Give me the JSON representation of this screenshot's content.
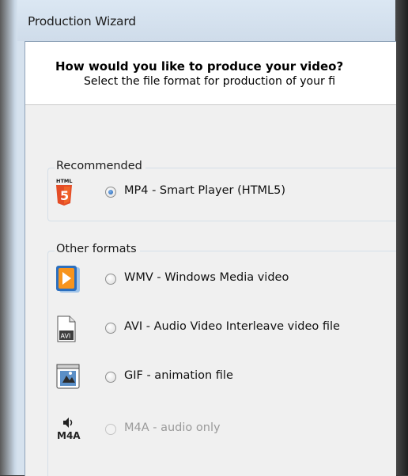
{
  "window": {
    "title": "Production Wizard"
  },
  "header": {
    "question": "How would you like to produce your video?",
    "subtitle": "Select the file format for production of your fi"
  },
  "groups": {
    "recommended": {
      "label": "Recommended",
      "options": [
        {
          "label": "MP4 - Smart Player (HTML5)",
          "checked": true,
          "enabled": true,
          "icon": "html5-icon"
        }
      ]
    },
    "other": {
      "label": "Other formats",
      "options": [
        {
          "label": "WMV - Windows Media video",
          "checked": false,
          "enabled": true,
          "icon": "windows-media-icon"
        },
        {
          "label": "AVI - Audio Video Interleave video file",
          "checked": false,
          "enabled": true,
          "icon": "avi-file-icon"
        },
        {
          "label": "GIF - animation file",
          "checked": false,
          "enabled": true,
          "icon": "gif-animation-icon"
        },
        {
          "label": "M4A - audio only",
          "checked": false,
          "enabled": false,
          "icon": "m4a-audio-icon"
        }
      ]
    }
  },
  "icon_text": {
    "html5_badge": "HTML",
    "html5_number": "5",
    "avi": "AVI",
    "m4a": "M4A"
  },
  "colors": {
    "html5_orange": "#e44d26",
    "wmv_blue": "#2b6fbf",
    "wmv_orange": "#f7941d",
    "radio_selected": "#1f5fb0"
  }
}
